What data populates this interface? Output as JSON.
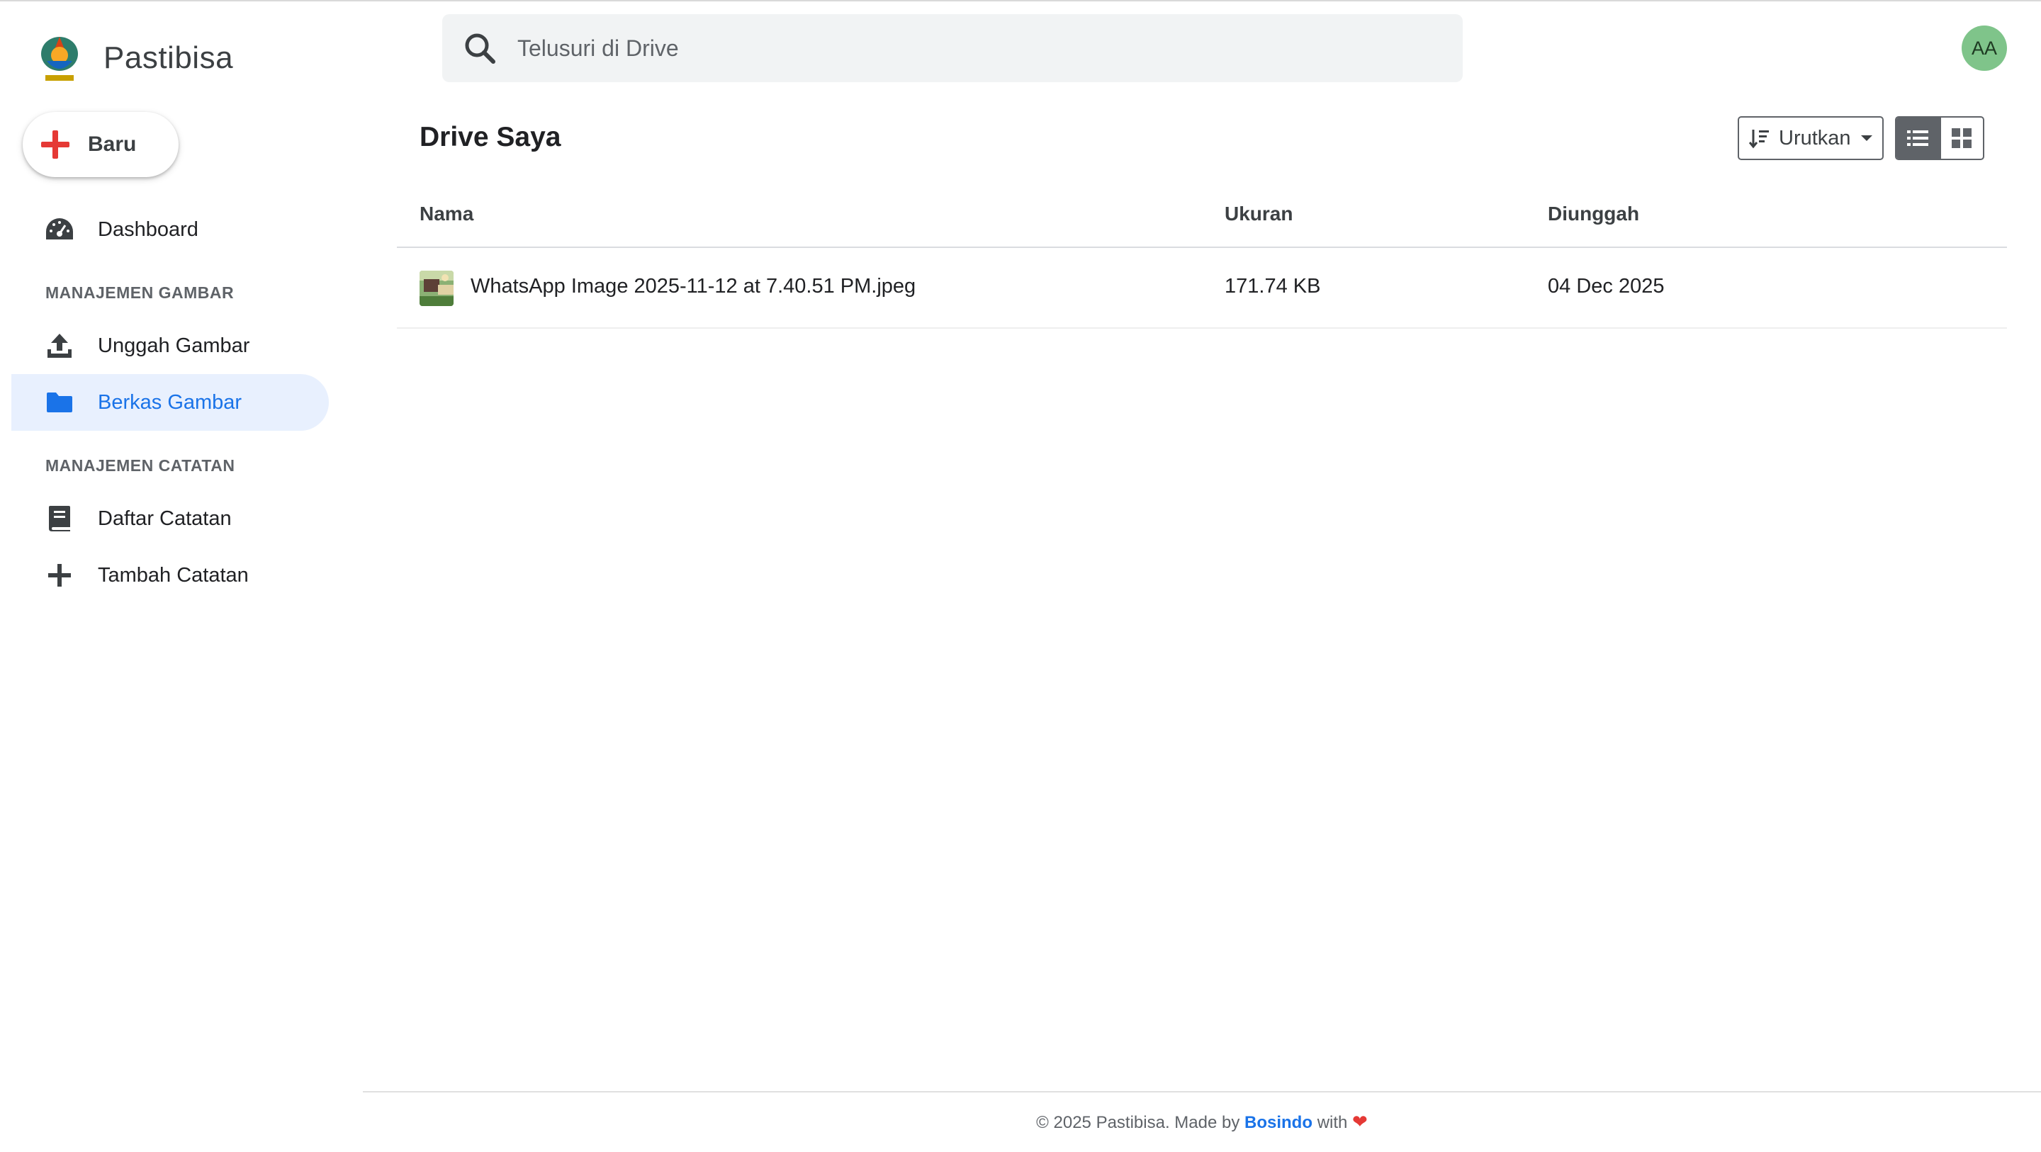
{
  "brand": {
    "name": "Pastibisa",
    "logo": "pastibisa-logo"
  },
  "new_button": {
    "label": "Baru",
    "icon": "plus-icon"
  },
  "sidebar": {
    "dashboard": {
      "label": "Dashboard",
      "icon": "gauge-icon"
    },
    "sections": [
      {
        "title": "MANAJEMEN GAMBAR",
        "items": [
          {
            "label": "Unggah Gambar",
            "icon": "upload-icon",
            "active": false
          },
          {
            "label": "Berkas Gambar",
            "icon": "folder-icon",
            "active": true
          }
        ]
      },
      {
        "title": "MANAJEMEN CATATAN",
        "items": [
          {
            "label": "Daftar Catatan",
            "icon": "book-icon",
            "active": false
          },
          {
            "label": "Tambah Catatan",
            "icon": "plus-icon",
            "active": false
          }
        ]
      }
    ]
  },
  "search": {
    "placeholder": "Telusuri di Drive",
    "value": ""
  },
  "user": {
    "initials": "AA",
    "avatar_color": "#7fc48a"
  },
  "main": {
    "title": "Drive Saya",
    "sort": {
      "label": "Urutkan"
    },
    "view": {
      "active": "list",
      "options": [
        "list",
        "grid"
      ]
    },
    "table": {
      "columns": [
        "Nama",
        "Ukuran",
        "Diunggah"
      ],
      "rows": [
        {
          "name": "WhatsApp Image 2025-11-12 at 7.40.51 PM.jpeg",
          "size": "171.74 KB",
          "uploaded": "04 Dec 2025"
        }
      ]
    }
  },
  "footer": {
    "prefix": "© 2025 Pastibisa. Made by",
    "link": "Bosindo",
    "suffix": "with"
  },
  "colors": {
    "accent": "#1a73e8",
    "active_bg": "#e8f0fe",
    "new_plus": "#e53935",
    "heart": "#e53935"
  }
}
